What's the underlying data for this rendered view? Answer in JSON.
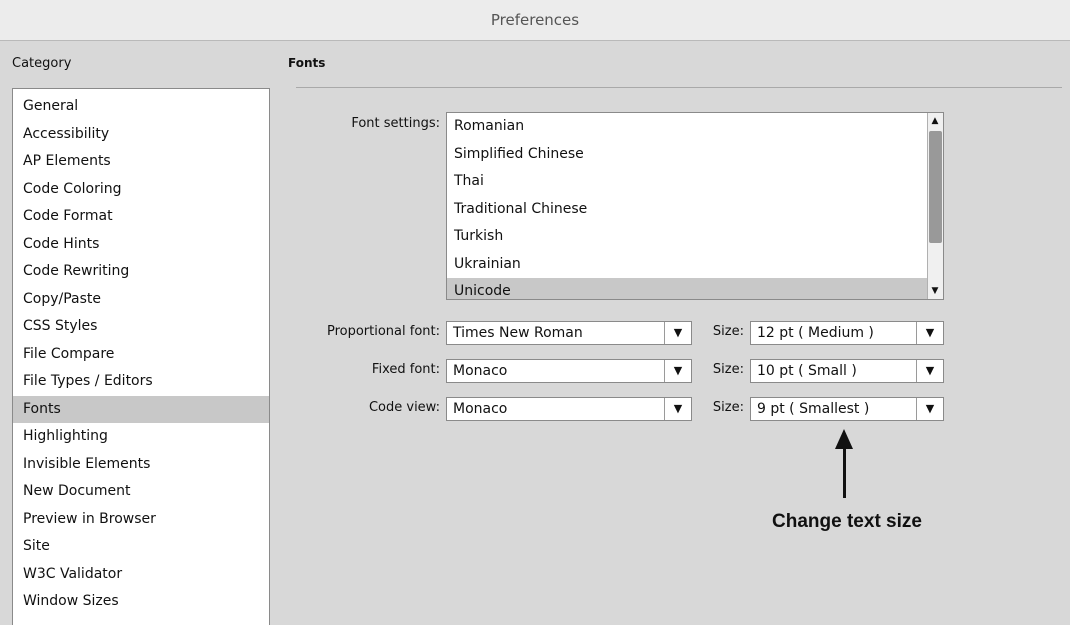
{
  "window": {
    "title": "Preferences"
  },
  "category": {
    "label": "Category",
    "items": [
      {
        "label": "General"
      },
      {
        "label": "Accessibility"
      },
      {
        "label": "AP Elements"
      },
      {
        "label": "Code Coloring"
      },
      {
        "label": "Code Format"
      },
      {
        "label": "Code Hints"
      },
      {
        "label": "Code Rewriting"
      },
      {
        "label": "Copy/Paste"
      },
      {
        "label": "CSS Styles"
      },
      {
        "label": "File Compare"
      },
      {
        "label": "File Types / Editors"
      },
      {
        "label": "Fonts",
        "selected": true
      },
      {
        "label": "Highlighting"
      },
      {
        "label": "Invisible Elements"
      },
      {
        "label": "New Document"
      },
      {
        "label": "Preview in Browser"
      },
      {
        "label": "Site"
      },
      {
        "label": "W3C Validator"
      },
      {
        "label": "Window Sizes"
      }
    ]
  },
  "fonts": {
    "title": "Fonts",
    "font_settings": {
      "label": "Font settings:",
      "items": [
        {
          "label": "Romanian"
        },
        {
          "label": "Simplified Chinese"
        },
        {
          "label": "Thai"
        },
        {
          "label": "Traditional Chinese"
        },
        {
          "label": "Turkish"
        },
        {
          "label": "Ukrainian"
        },
        {
          "label": "Unicode",
          "selected": true
        }
      ]
    },
    "proportional": {
      "label": "Proportional font:",
      "value": "Times New Roman",
      "size_label": "Size:",
      "size_value": "12 pt  ( Medium )"
    },
    "fixed": {
      "label": "Fixed font:",
      "value": "Monaco",
      "size_label": "Size:",
      "size_value": "10 pt  ( Small )"
    },
    "code_view": {
      "label": "Code view:",
      "value": "Monaco",
      "size_label": "Size:",
      "size_value": "9 pt    ( Smallest )"
    }
  },
  "annotation": {
    "text": "Change text size"
  },
  "icons": {
    "dropdown": "▼",
    "scroll_up": "▲",
    "scroll_down": "▼"
  },
  "colors": {
    "selected_row": "#c8c8c8",
    "background": "#d8d8d8"
  }
}
